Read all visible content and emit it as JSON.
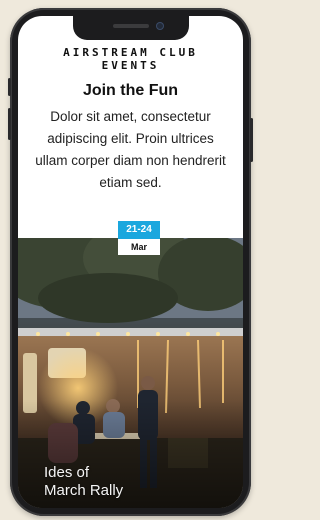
{
  "header": {
    "club_title": "AIRSTREAM CLUB\nEVENTS",
    "heading": "Join the Fun",
    "body": "Dolor sit amet, consectetur adipiscing elit. Proin ultrices ullam corper diam non hendrerit etiam sed."
  },
  "event": {
    "date_day": "21-24",
    "date_month": "Mar",
    "title": "Ides of\nMarch Rally"
  },
  "colors": {
    "accent": "#1aa7de",
    "background": "#efe9dc",
    "phone_frame": "#1c1c1e"
  }
}
